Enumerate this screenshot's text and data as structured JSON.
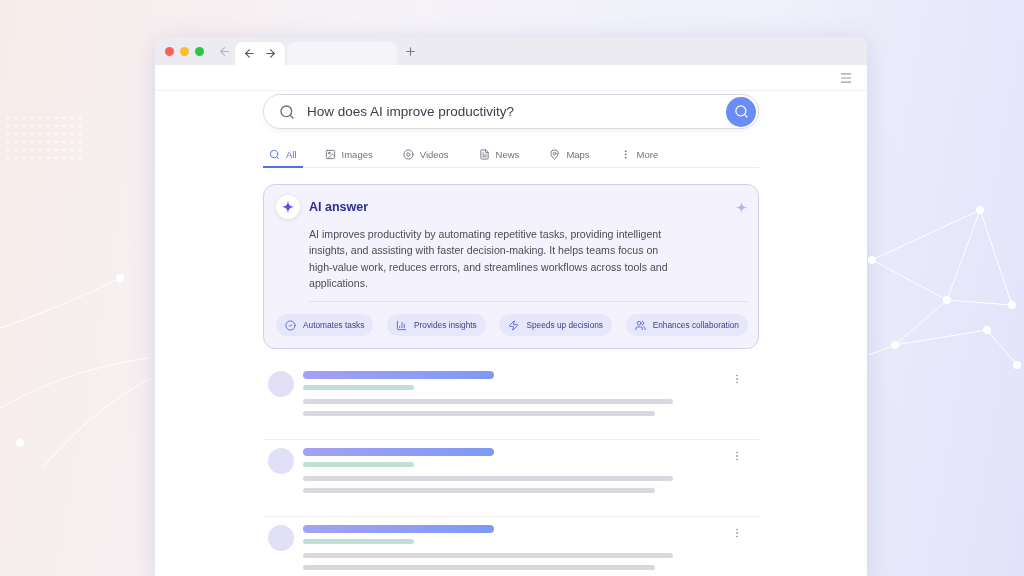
{
  "search": {
    "value": "How does AI improve productivity?"
  },
  "tabs": [
    {
      "label": "All",
      "selected": true
    },
    {
      "label": "Images",
      "selected": false
    },
    {
      "label": "Videos",
      "selected": false
    },
    {
      "label": "News",
      "selected": false
    },
    {
      "label": "Maps",
      "selected": false
    },
    {
      "label": "More",
      "selected": false
    }
  ],
  "ai_answer": {
    "title": "AI answer",
    "text": "AI improves productivity by automating repetitive tasks, providing intelligent insights, and assisting with faster decision-making. It helps teams focus on high-value work, reduces errors, and streamlines workflows across tools and applications.",
    "chips": [
      {
        "label": "Automates tasks"
      },
      {
        "label": "Provides insights"
      },
      {
        "label": "Speeds up decisions"
      },
      {
        "label": "Enhances collaboration"
      }
    ]
  },
  "results": [
    {
      "kind": "placeholder"
    },
    {
      "kind": "placeholder"
    },
    {
      "kind": "placeholder"
    }
  ]
}
